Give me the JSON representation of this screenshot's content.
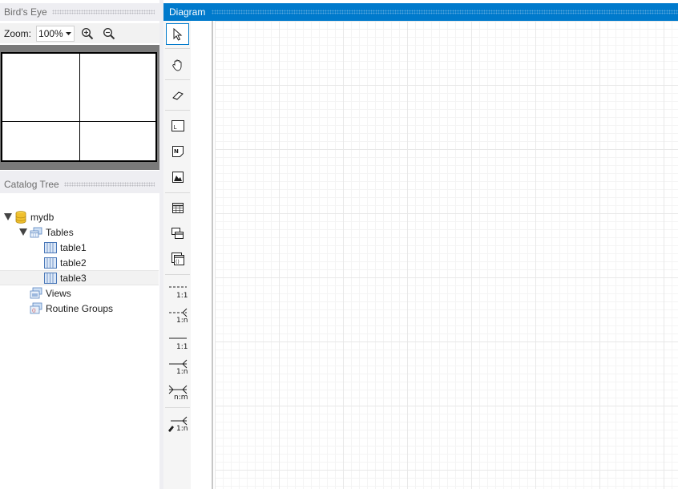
{
  "birds_eye": {
    "title": "Bird's Eye",
    "zoom_label": "Zoom:",
    "zoom_value": "100%"
  },
  "catalog": {
    "title": "Catalog Tree",
    "items": [
      {
        "label": "mydb",
        "icon": "database-icon",
        "expanded": true
      },
      {
        "label": "Tables",
        "icon": "tables-folder-icon",
        "expanded": true
      },
      {
        "label": "table1",
        "icon": "table-icon"
      },
      {
        "label": "table2",
        "icon": "table-icon"
      },
      {
        "label": "table3",
        "icon": "table-icon",
        "selected": true
      },
      {
        "label": "Views",
        "icon": "views-folder-icon"
      },
      {
        "label": "Routine Groups",
        "icon": "routine-groups-icon"
      }
    ]
  },
  "diagram": {
    "title": "Diagram",
    "toolbar": [
      {
        "name": "select-tool",
        "icon": "pointer-icon",
        "active": true
      },
      {
        "name": "hand-tool",
        "icon": "hand-icon"
      },
      {
        "name": "eraser-tool",
        "icon": "eraser-icon"
      },
      {
        "name": "layer-tool",
        "icon": "layer-icon",
        "glyph": "L"
      },
      {
        "name": "note-tool",
        "icon": "note-icon",
        "glyph": "N"
      },
      {
        "name": "image-tool",
        "icon": "image-icon"
      },
      {
        "name": "table-tool",
        "icon": "table-grid-icon"
      },
      {
        "name": "view-tool",
        "icon": "view-icon"
      },
      {
        "name": "routine-tool",
        "icon": "routine-icon"
      },
      {
        "name": "relation-1-1-non-identifying",
        "icon": "relation-dashed-icon",
        "label": "1:1"
      },
      {
        "name": "relation-1-n-non-identifying",
        "icon": "relation-dashed-crowfoot-icon",
        "label": "1:n"
      },
      {
        "name": "relation-1-1-identifying",
        "icon": "relation-solid-icon",
        "label": "1:1"
      },
      {
        "name": "relation-1-n-identifying",
        "icon": "relation-solid-crowfoot-icon",
        "label": "1:n"
      },
      {
        "name": "relation-n-m",
        "icon": "relation-nm-icon",
        "label": "n:m"
      },
      {
        "name": "relation-1-n-existing-columns",
        "icon": "relation-pick-icon",
        "label": "1:n"
      }
    ]
  }
}
